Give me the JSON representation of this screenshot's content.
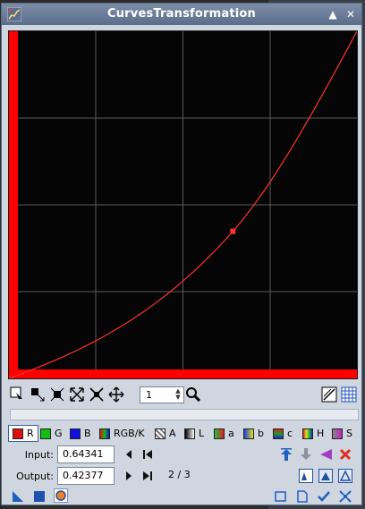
{
  "window": {
    "title": "CurvesTransformation"
  },
  "curve": {
    "point_count": "1",
    "selected_point": {
      "x": 0.64341,
      "y": 0.42377
    },
    "grid": "on"
  },
  "channels": {
    "items": [
      {
        "label": "R",
        "color": "#e01010",
        "selected": true
      },
      {
        "label": "G",
        "color": "#10c010",
        "selected": false
      },
      {
        "label": "B",
        "color": "#1010e0",
        "selected": false
      },
      {
        "label": "RGB/K",
        "color": "#808080",
        "selected": false
      },
      {
        "label": "A",
        "color": "#ffffff",
        "selected": false
      },
      {
        "label": "L",
        "color": "#888888",
        "selected": false
      },
      {
        "label": "a",
        "color": "#e08020",
        "selected": false
      },
      {
        "label": "b",
        "color": "#d0d020",
        "selected": false
      },
      {
        "label": "c",
        "color": "#a040a0",
        "selected": false
      },
      {
        "label": "H",
        "color": "#e06060",
        "selected": false
      },
      {
        "label": "S",
        "color": "#8040c0",
        "selected": false
      }
    ]
  },
  "input": {
    "label": "Input:",
    "value": "0.64341"
  },
  "output": {
    "label": "Output:",
    "value": "0.42377"
  },
  "page_info": "2 / 3",
  "colors": {
    "accent": "#3b5fa0",
    "curve": "#ff3030",
    "channel_bar": "#ff0000"
  }
}
